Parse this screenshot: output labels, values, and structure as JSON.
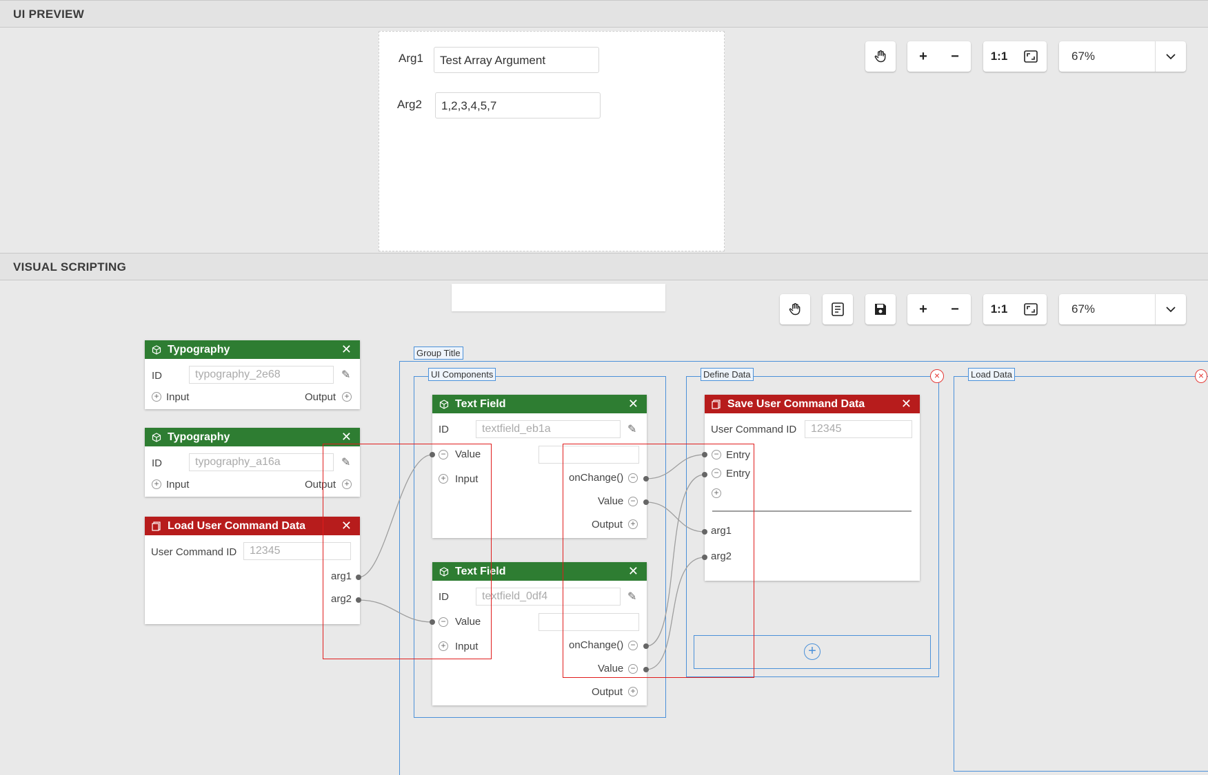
{
  "preview": {
    "title": "UI PREVIEW",
    "arg1_label": "Arg1",
    "arg1_value": "Test Array Argument",
    "arg2_label": "Arg2",
    "arg2_value": "1,2,3,4,5,7",
    "toolbar": {
      "pan_icon": "hand-icon",
      "zoom_in": "+",
      "zoom_out": "−",
      "reset": "1:1",
      "fit_icon": "fit-screen-icon",
      "zoom": "67%"
    }
  },
  "scripting": {
    "title": "VISUAL SCRIPTING",
    "toolbar": {
      "pan_icon": "hand-icon",
      "doc_icon": "document-icon",
      "save_icon": "save-icon",
      "zoom_in": "+",
      "zoom_out": "−",
      "reset": "1:1",
      "fit_icon": "fit-screen-icon",
      "zoom": "67%"
    },
    "typography1": {
      "title": "Typography",
      "id_label": "ID",
      "id_value": "typography_2e68",
      "input": "Input",
      "output": "Output"
    },
    "typography2": {
      "title": "Typography",
      "id_label": "ID",
      "id_value": "typography_a16a",
      "input": "Input",
      "output": "Output"
    },
    "load_node": {
      "title": "Load User Command Data",
      "uc_label": "User Command ID",
      "uc_value": "12345",
      "arg1": "arg1",
      "arg2": "arg2"
    },
    "groups": {
      "group_title": "Group Title",
      "ui_components": "UI Components",
      "define_data": "Define Data",
      "load_data": "Load Data"
    },
    "textfield1": {
      "title": "Text Field",
      "id_label": "ID",
      "id_value": "textfield_eb1a",
      "value": "Value",
      "input": "Input",
      "onchange": "onChange()",
      "value_out": "Value",
      "output": "Output"
    },
    "textfield2": {
      "title": "Text Field",
      "id_label": "ID",
      "id_value": "textfield_0df4",
      "value": "Value",
      "input": "Input",
      "onchange": "onChange()",
      "value_out": "Value",
      "output": "Output"
    },
    "save_node": {
      "title": "Save User Command Data",
      "uc_label": "User Command ID",
      "uc_value": "12345",
      "entry1": "Entry",
      "entry2": "Entry",
      "arg1": "arg1",
      "arg2": "arg2"
    },
    "colors": {
      "green": "#2e7d32",
      "red": "#b71c1c",
      "group_border": "#4a90d9",
      "highlight": "#e01b1b"
    }
  }
}
